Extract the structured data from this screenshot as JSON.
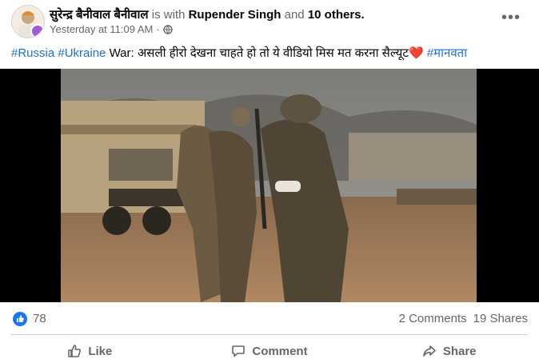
{
  "post": {
    "author": "सुरेन्द्र बैनीवाल बैनीवाल",
    "with_text": "is with",
    "tagged_person": "Rupender Singh",
    "and_text": "and",
    "others": "10 others.",
    "timestamp": "Yesterday at 11:09 AM",
    "separator": "·",
    "privacy_icon": "globe-icon",
    "more_icon": "more-options-icon"
  },
  "caption": {
    "tag1": "#Russia",
    "tag2": "#Ukraine",
    "text": "War: असली हीरो देखना चाहते हो तो ये वीडियो मिस मत करना  सैल्यूट",
    "emoji": "❤️",
    "tag3": "#मानवता"
  },
  "reactions": {
    "like_count": "78",
    "comments": "2 Comments",
    "shares": "19 Shares"
  },
  "actions": {
    "like": "Like",
    "comment": "Comment",
    "share": "Share"
  },
  "colors": {
    "link": "#216fdb",
    "like_blue": "#1877f2",
    "muted": "#65676b"
  }
}
